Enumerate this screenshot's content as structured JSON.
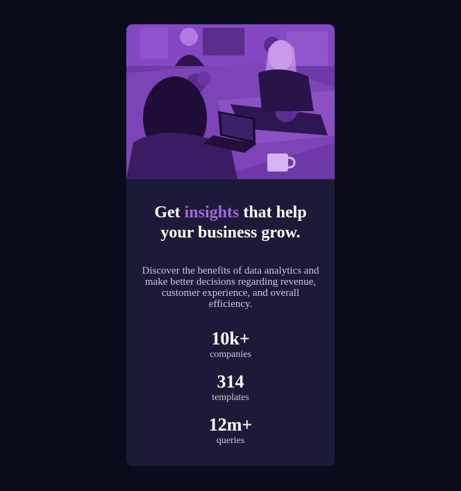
{
  "card": {
    "title_prefix": "Get ",
    "title_accent": "insights",
    "title_suffix": " that help your business grow.",
    "description": "Discover the benefits of data analytics and make better decisions regarding revenue, customer experience, and overall efficiency.",
    "stats": [
      {
        "value": "10k+",
        "label": "companies"
      },
      {
        "value": "314",
        "label": "templates"
      },
      {
        "value": "12m+",
        "label": "queries"
      }
    ]
  },
  "colors": {
    "page_background": "#0a0c1b",
    "card_background": "#1c1a38",
    "accent": "#a765d9",
    "image_tint": "#8a4bc8"
  }
}
